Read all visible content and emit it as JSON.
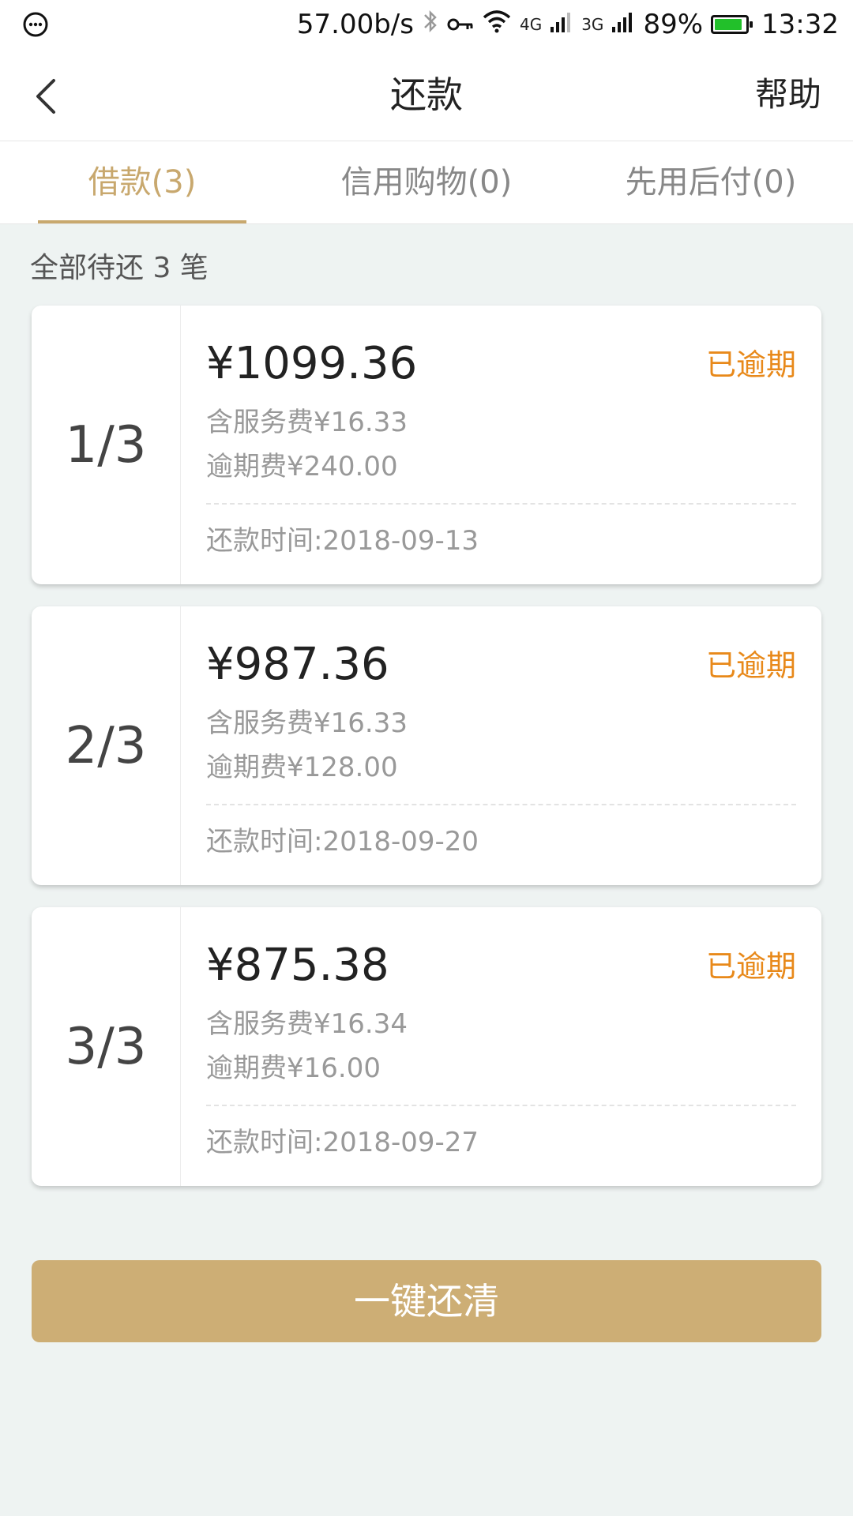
{
  "status_bar": {
    "net_speed": "57.00b/s",
    "net_4g": "4G",
    "net_3g": "3G",
    "battery": "89%",
    "battery_level": 0.89,
    "time": "13:32",
    "battery_color": "#22c02a"
  },
  "nav": {
    "title": "还款",
    "help": "帮助"
  },
  "tabs": [
    {
      "label": "借款(3)",
      "active": true
    },
    {
      "label": "信用购物(0)",
      "active": false
    },
    {
      "label": "先用后付(0)",
      "active": false
    }
  ],
  "summary": "全部待还 3 笔",
  "cards": [
    {
      "index": "1/3",
      "amount": "¥1099.36",
      "service_fee": "含服务费¥16.33",
      "late_fee": "逾期费¥240.00",
      "repay_date": "还款时间:2018-09-13",
      "status": "已逾期"
    },
    {
      "index": "2/3",
      "amount": "¥987.36",
      "service_fee": "含服务费¥16.33",
      "late_fee": "逾期费¥128.00",
      "repay_date": "还款时间:2018-09-20",
      "status": "已逾期"
    },
    {
      "index": "3/3",
      "amount": "¥875.38",
      "service_fee": "含服务费¥16.34",
      "late_fee": "逾期费¥16.00",
      "repay_date": "还款时间:2018-09-27",
      "status": "已逾期"
    }
  ],
  "pay_all_label": "一键还清",
  "colors": {
    "accent_gold": "#c8a86e",
    "button_gold": "#cdae75",
    "overdue_orange": "#e8891a",
    "background": "#eef3f2"
  }
}
